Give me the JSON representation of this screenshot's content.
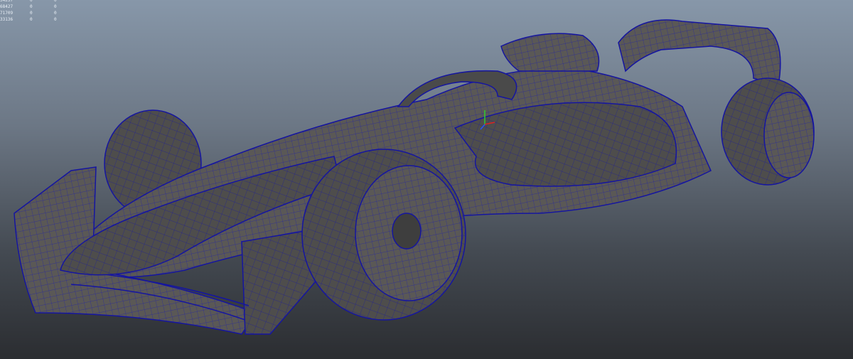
{
  "viewport": {
    "background_top": "#8797a9",
    "background_bottom": "#2b2d31",
    "mesh_color": "#5a5856",
    "wire_color": "#1a1aa0"
  },
  "hud": {
    "rows": [
      [
        "34237",
        "0",
        "0"
      ],
      [
        "68427",
        "0",
        "0"
      ],
      [
        "71709",
        "0",
        "0"
      ],
      [
        "33136",
        "0",
        "0"
      ]
    ]
  }
}
